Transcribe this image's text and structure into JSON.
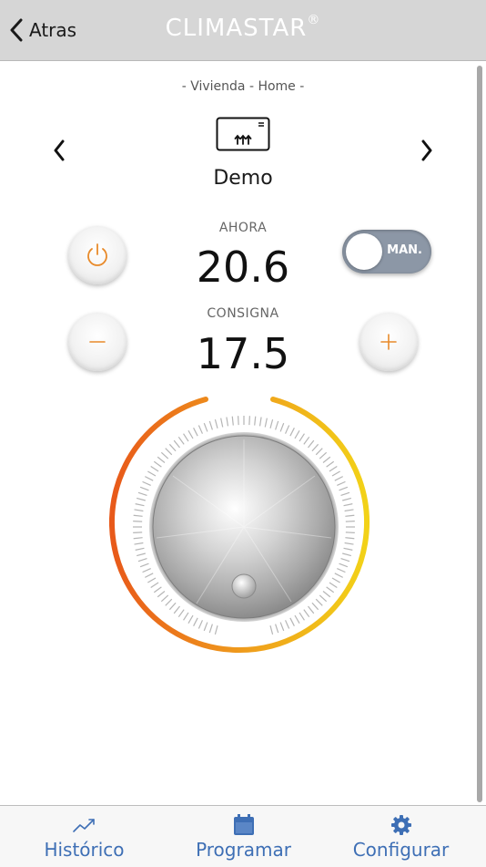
{
  "header": {
    "back_label": "Atras",
    "title": "CLIMASTAR",
    "title_mark": "®"
  },
  "device": {
    "location": "- Vivienda - Home -",
    "name": "Demo"
  },
  "readings": {
    "current_label": "AHORA",
    "current_value": "20.6",
    "setpoint_label": "CONSIGNA",
    "setpoint_value": "17.5"
  },
  "mode_toggle": {
    "label": "MAN."
  },
  "tabbar": {
    "items": [
      {
        "label": "Histórico",
        "icon": "trend-chart-icon"
      },
      {
        "label": "Programar",
        "icon": "calendar-icon"
      },
      {
        "label": "Configurar",
        "icon": "gear-icon"
      }
    ]
  },
  "colors": {
    "header_bg": "#d6d6d6",
    "accent_orange": "#e88a2a",
    "tab_blue": "#3e6fb5",
    "arc_start": "#e8591a",
    "arc_end": "#f2d218",
    "toggle_bg": "#8c97a6"
  }
}
